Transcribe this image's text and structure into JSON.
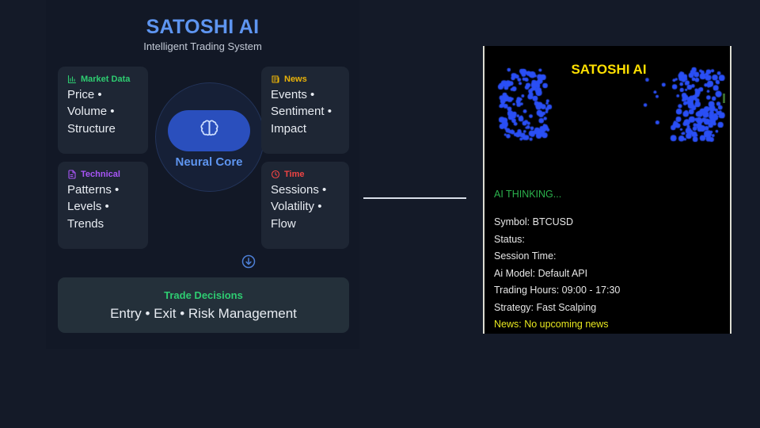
{
  "brand": {
    "title": "SATOSHI AI",
    "subtitle": "Intelligent Trading System",
    "accent": "#5e95f0"
  },
  "nodes": [
    {
      "key": "market-data",
      "icon": "bar-chart-icon",
      "header": "Market Data",
      "color": "#2ecc71",
      "lines": [
        "Price •",
        "Volume •",
        "Structure"
      ]
    },
    {
      "key": "technical",
      "icon": "document-icon",
      "header": "Technical",
      "color": "#a855f7",
      "lines": [
        "Patterns •",
        "Levels •",
        "Trends"
      ]
    },
    {
      "key": "news",
      "icon": "newspaper-icon",
      "header": "News",
      "color": "#eab308",
      "lines": [
        "Events •",
        "Sentiment •",
        "Impact"
      ]
    },
    {
      "key": "time",
      "icon": "clock-icon",
      "header": "Time",
      "color": "#ef4444",
      "lines": [
        "Sessions •",
        "Volatility •",
        "Flow"
      ]
    }
  ],
  "core": {
    "icon": "brain-icon",
    "label": "Neural Core",
    "color": "#2a4fbd"
  },
  "flow": {
    "arrow_icon": "circle-arrow-down-icon"
  },
  "decisions": {
    "title": "Trade Decisions",
    "body": "Entry • Exit • Risk Management",
    "title_color": "#2ecc71"
  },
  "terminal": {
    "title": "SATOSHI AI",
    "title_color": "#ffe000",
    "status_text": "AI THINKING...",
    "status_color": "#2bb24c",
    "dot_color": "#2a4ff5",
    "info": [
      {
        "key": "symbol",
        "text": "Symbol: BTCUSD"
      },
      {
        "key": "status",
        "text": "Status:"
      },
      {
        "key": "session-time",
        "text": "Session Time:"
      },
      {
        "key": "ai-model",
        "text": "Ai Model: Default API"
      },
      {
        "key": "trading-hours",
        "text": "Trading Hours: 09:00 - 17:30"
      },
      {
        "key": "strategy",
        "text": "Strategy: Fast Scalping"
      },
      {
        "key": "news",
        "text": "News: No upcoming news",
        "highlight": true
      }
    ]
  }
}
